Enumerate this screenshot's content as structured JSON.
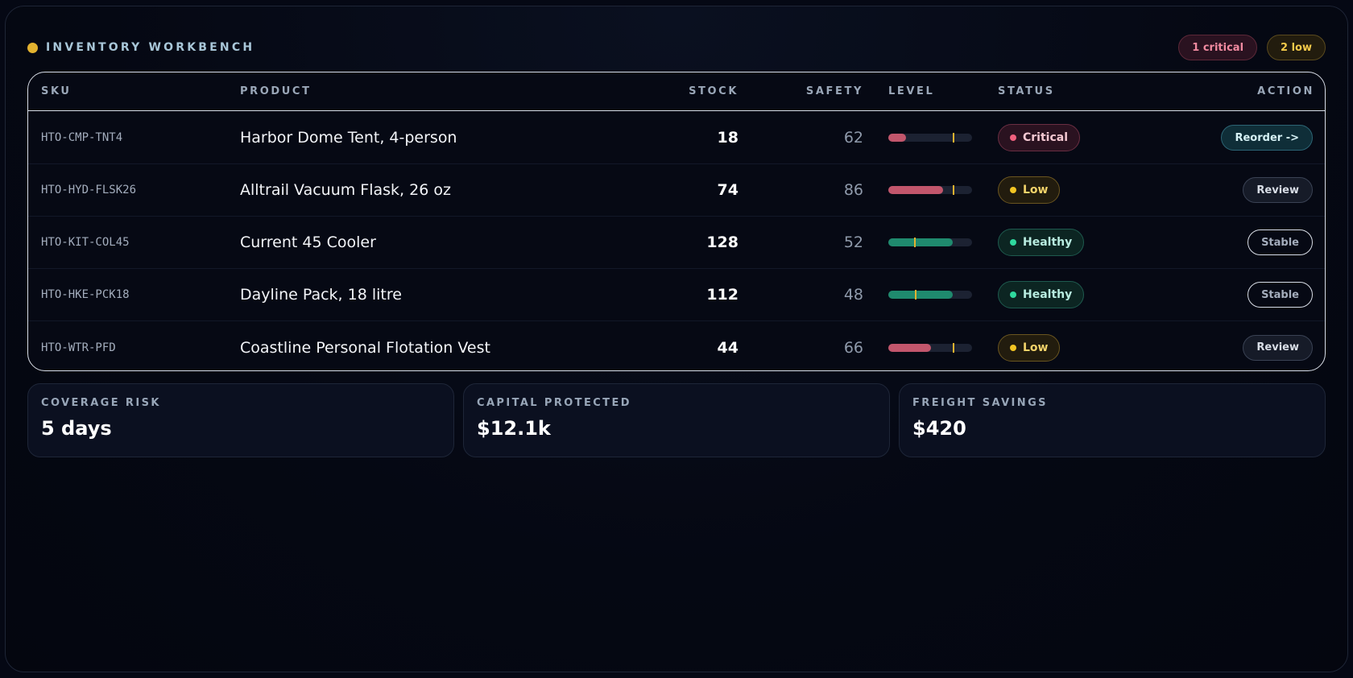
{
  "header": {
    "title": "INVENTORY WORKBENCH",
    "badges": {
      "critical": "1 critical",
      "low": "2 low"
    }
  },
  "table": {
    "columns": {
      "sku": "SKU",
      "product": "PRODUCT",
      "stock": "STOCK",
      "safety": "SAFETY",
      "level": "LEVEL",
      "status": "STATUS",
      "action": "ACTION"
    },
    "rows": [
      {
        "sku": "HTO-CMP-TNT4",
        "product": "Harbor Dome Tent, 4-person",
        "stock": "18",
        "safety": "62",
        "level_fill": 0.21,
        "safety_marker": 0.77,
        "status": "Critical",
        "status_kind": "critical",
        "action": "Reorder ->",
        "action_kind": "reorder"
      },
      {
        "sku": "HTO-HYD-FLSK26",
        "product": "Alltrail Vacuum Flask, 26 oz",
        "stock": "74",
        "safety": "86",
        "level_fill": 0.65,
        "safety_marker": 0.77,
        "status": "Low",
        "status_kind": "low",
        "action": "Review",
        "action_kind": "review"
      },
      {
        "sku": "HTO-KIT-COL45",
        "product": "Current 45 Cooler",
        "stock": "128",
        "safety": "52",
        "level_fill": 0.77,
        "safety_marker": 0.31,
        "status": "Healthy",
        "status_kind": "healthy",
        "action": "Stable",
        "action_kind": "stable"
      },
      {
        "sku": "HTO-HKE-PCK18",
        "product": "Dayline Pack, 18 litre",
        "stock": "112",
        "safety": "48",
        "level_fill": 0.77,
        "safety_marker": 0.32,
        "status": "Healthy",
        "status_kind": "healthy",
        "action": "Stable",
        "action_kind": "stable"
      },
      {
        "sku": "HTO-WTR-PFD",
        "product": "Coastline Personal Flotation Vest",
        "stock": "44",
        "safety": "66",
        "level_fill": 0.51,
        "safety_marker": 0.77,
        "status": "Low",
        "status_kind": "low",
        "action": "Review",
        "action_kind": "review"
      }
    ]
  },
  "colors": {
    "critical_fill": "#c2566c",
    "low_fill": "#c2566c",
    "healthy_fill": "#1f8a6e",
    "safety_marker": "#e3b22f"
  },
  "cards": [
    {
      "label": "COVERAGE RISK",
      "value": "5 days"
    },
    {
      "label": "CAPITAL PROTECTED",
      "value": "$12.1k"
    },
    {
      "label": "FREIGHT SAVINGS",
      "value": "$420"
    }
  ]
}
